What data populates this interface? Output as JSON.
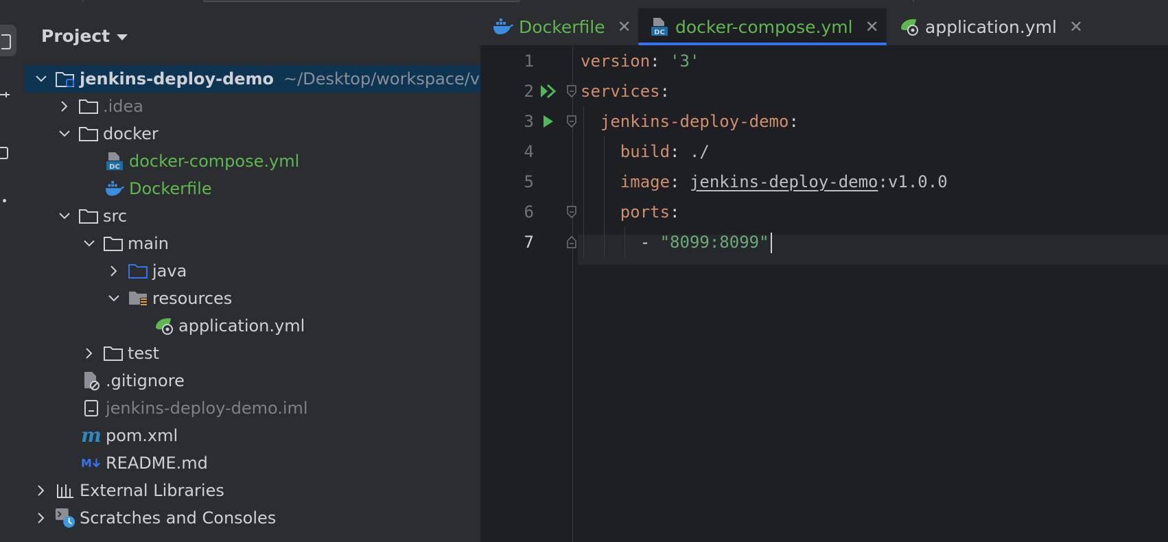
{
  "colors": {
    "panel_bg": "#2b2d30",
    "editor_bg": "#1e1f22",
    "selection": "#0d3450",
    "accent": "#3574f0",
    "vcs_added": "#5fb84f",
    "yaml_key": "#cf8e6d",
    "yaml_string": "#6aab73"
  },
  "project_panel": {
    "title": "Project",
    "tree": [
      {
        "label": "jenkins-deploy-demo",
        "path": "~/Desktop/workspace/v",
        "icon": "module-folder-icon",
        "expanded": true,
        "selected": true
      },
      {
        "label": ".idea",
        "icon": "folder-icon",
        "expanded": false
      },
      {
        "label": "docker",
        "icon": "folder-icon",
        "expanded": true
      },
      {
        "label": "docker-compose.yml",
        "icon": "docker-compose-file-icon"
      },
      {
        "label": "Dockerfile",
        "icon": "docker-icon"
      },
      {
        "label": "src",
        "icon": "folder-icon",
        "expanded": true
      },
      {
        "label": "main",
        "icon": "folder-icon",
        "expanded": true
      },
      {
        "label": "java",
        "icon": "source-folder-icon",
        "expanded": false
      },
      {
        "label": "resources",
        "icon": "resources-folder-icon",
        "expanded": true
      },
      {
        "label": "application.yml",
        "icon": "spring-config-icon"
      },
      {
        "label": "test",
        "icon": "folder-icon",
        "expanded": false
      },
      {
        "label": ".gitignore",
        "icon": "ignore-file-icon"
      },
      {
        "label": "jenkins-deploy-demo.iml",
        "icon": "iml-file-icon"
      },
      {
        "label": "pom.xml",
        "icon": "maven-icon"
      },
      {
        "label": "README.md",
        "icon": "markdown-icon"
      },
      {
        "label": "External Libraries",
        "icon": "libraries-icon",
        "expanded": false
      },
      {
        "label": "Scratches and Consoles",
        "icon": "scratches-icon",
        "expanded": false
      }
    ]
  },
  "editor": {
    "tabs": [
      {
        "label": "Dockerfile",
        "icon": "docker-icon",
        "active": false,
        "close": "✕"
      },
      {
        "label": "docker-compose.yml",
        "icon": "docker-compose-file-icon",
        "active": true,
        "close": "✕"
      },
      {
        "label": "application.yml",
        "icon": "spring-config-icon",
        "active": false,
        "close": "✕"
      }
    ],
    "line_numbers": [
      "1",
      "2",
      "3",
      "4",
      "5",
      "6",
      "7"
    ],
    "current_line": "7",
    "code": {
      "l1_key": "version",
      "l1_colon": ":",
      "l1_value": "'3'",
      "l2_key": "services",
      "l2_colon": ":",
      "l3_key": "jenkins-deploy-demo",
      "l3_colon": ":",
      "l4_key": "build",
      "l4_colon": ":",
      "l4_value": "./",
      "l5_key": "image",
      "l5_colon": ":",
      "l5_link": "jenkins-deploy-demo",
      "l5_rest": ":v1.0.0",
      "l6_key": "ports",
      "l6_colon": ":",
      "l7_dash": "-",
      "l7_value": "\"8099:8099\""
    }
  }
}
